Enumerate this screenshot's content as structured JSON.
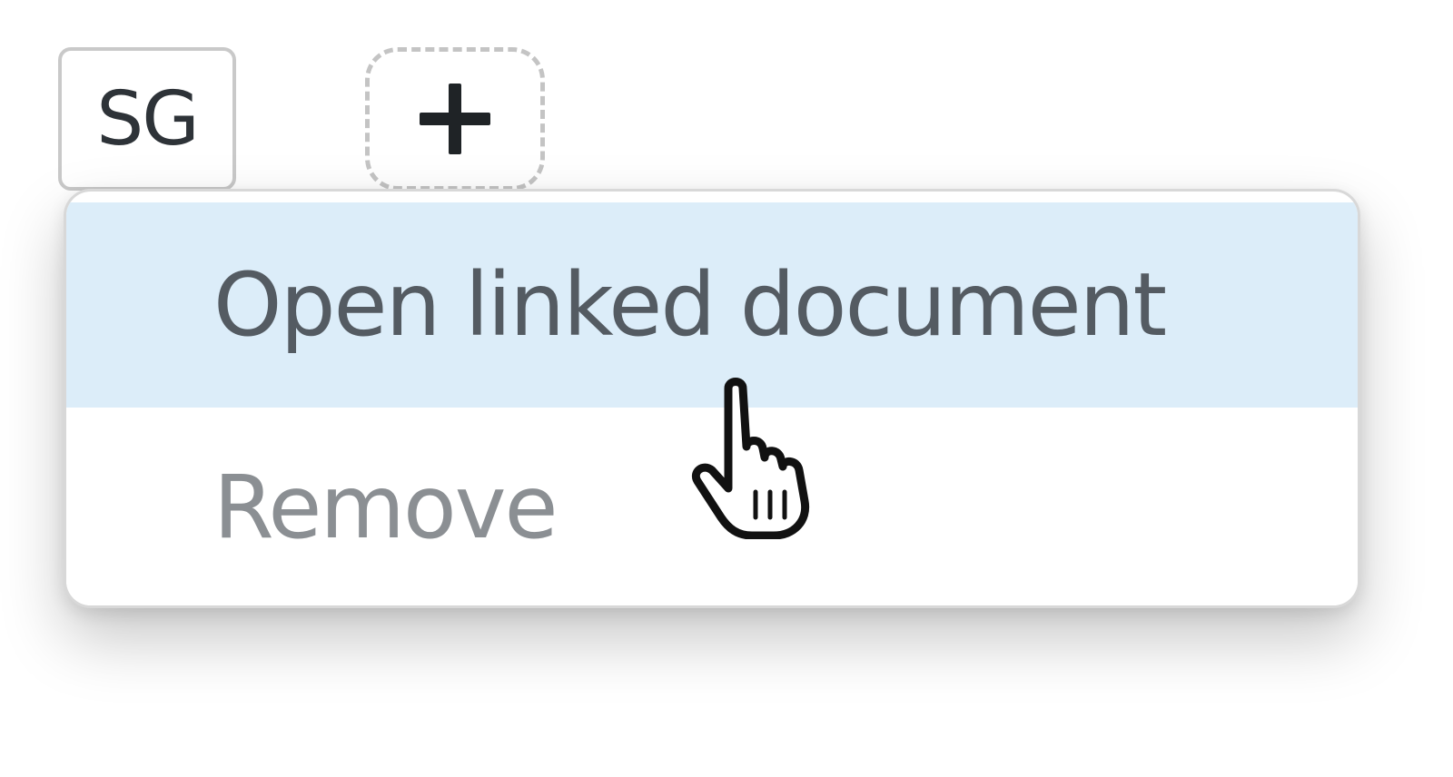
{
  "chip": {
    "label": "SG"
  },
  "add_button": {
    "icon": "plus-icon",
    "color": "#1f2326"
  },
  "context_menu": {
    "items": [
      {
        "label": "Open linked document",
        "state": "hovered",
        "highlight_color": "#dcedf9"
      },
      {
        "label": "Remove",
        "state": "normal"
      }
    ]
  },
  "cursor": {
    "icon": "hand-pointer-icon"
  }
}
